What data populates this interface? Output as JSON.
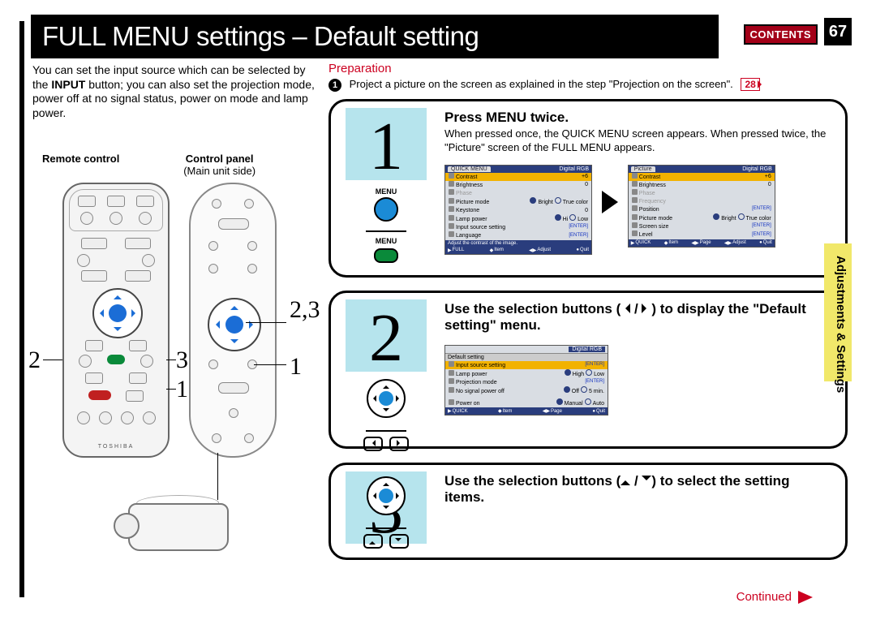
{
  "page": {
    "title": "FULL MENU settings – Default setting",
    "contents_label": "CONTENTS",
    "number": "67",
    "continued": "Continued",
    "side_tab": "Adjustments &\nSettings"
  },
  "intro": {
    "text_before": "You can set the input source which can be selected by the ",
    "input_word": "INPUT",
    "text_after": " button; you can also set the projection mode, power off at no signal status, power on mode and lamp power."
  },
  "labels": {
    "remote": "Remote control",
    "panel": "Control panel",
    "main_unit": "(Main unit side)"
  },
  "callouts": {
    "right_23": "2,3",
    "right_1": "1",
    "left_2": "2",
    "mid_3": "3",
    "mid_1": "1"
  },
  "preparation": {
    "heading": "Preparation",
    "bullet_num": "1",
    "text": "Project a picture on the screen as explained in the step \"Projection on the screen\".",
    "page_ref": "28"
  },
  "steps": {
    "s1": {
      "num": "1",
      "menu_label_top": "MENU",
      "menu_label_bottom": "MENU",
      "title": "Press MENU twice.",
      "body": "When pressed once, the QUICK MENU screen appears. When pressed twice, the \"Picture\" screen of the FULL MENU appears."
    },
    "s2": {
      "num": "2",
      "title_a": "Use the selection buttons (",
      "title_b": " / ",
      "title_c": ") to display the \"Default setting\" menu."
    },
    "s3": {
      "num": "3",
      "title_a": "Use the selection buttons (",
      "title_b": " / ",
      "title_c": ") to select the setting items."
    }
  },
  "osd": {
    "quick": {
      "tab": "QUICK MENU",
      "source": "Digital RGB",
      "rows": [
        {
          "label": "Contrast",
          "val": "+6",
          "hl": true
        },
        {
          "label": "Brightness",
          "val": "0"
        },
        {
          "label": "Phase",
          "val": "",
          "grey": true
        },
        {
          "label": "Picture mode",
          "opt1": "Bright",
          "opt2": "True color"
        },
        {
          "label": "Keystone",
          "val": "0"
        },
        {
          "label": "Lamp power",
          "opt1": "Hi",
          "opt2": "Low"
        },
        {
          "label": "Input source setting",
          "enter": true
        },
        {
          "label": "Language",
          "enter": true
        }
      ],
      "hint": "Adjust the contrast of the image.",
      "foot": [
        "FULL",
        "Item",
        "Adjust",
        "Quit"
      ]
    },
    "picture": {
      "tab": "Picture",
      "source": "Digital RGB",
      "rows": [
        {
          "label": "Contrast",
          "val": "+6",
          "hl": true
        },
        {
          "label": "Brightness",
          "val": "0"
        },
        {
          "label": "Phase",
          "val": "",
          "grey": true
        },
        {
          "label": "Frequency",
          "val": "",
          "grey": true
        },
        {
          "label": "Position",
          "enter": true
        },
        {
          "label": "Picture mode",
          "opt1": "Bright",
          "opt2": "True color"
        },
        {
          "label": "Screen size",
          "enter": true
        },
        {
          "label": "Level",
          "enter": true
        }
      ],
      "foot": [
        "QUICK",
        "Item",
        "Page",
        "Adjust",
        "Quit"
      ]
    },
    "default": {
      "tab": "Default setting",
      "source": "Digital RGB",
      "rows": [
        {
          "label": "Input source setting",
          "enter": true,
          "hl": true
        },
        {
          "label": "Lamp power",
          "opt1": "High",
          "opt2": "Low"
        },
        {
          "label": "Projection mode",
          "enter": true
        },
        {
          "label": "No signal power off",
          "opt1": "Off",
          "opt2": "5 min."
        },
        {
          "label": "Power on",
          "opt1": "Manual",
          "opt2": "Auto"
        }
      ],
      "foot": [
        "QUICK",
        "Item",
        "Page",
        "Quit"
      ]
    }
  }
}
